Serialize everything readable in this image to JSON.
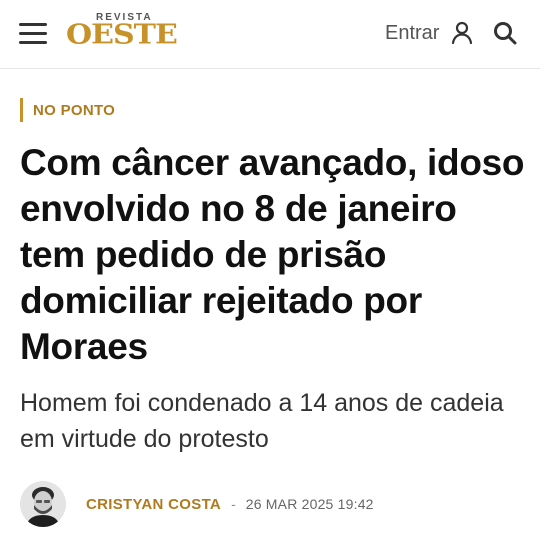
{
  "header": {
    "menu_icon": "hamburger-menu-icon",
    "logo_small": "REVISTA",
    "logo_main": "OESTE",
    "login_label": "Entrar",
    "user_icon": "user-icon",
    "search_icon": "search-icon",
    "brand_color": "#c8922a"
  },
  "article": {
    "section": "NO PONTO",
    "headline": "Com câncer avançado, idoso envolvido no 8 de janeiro tem pedido de prisão domiciliar rejeitado por Moraes",
    "subtitle": "Homem foi condenado a 14 anos de cadeia em virtude do protesto",
    "author": "CRISTYAN COSTA",
    "separator": "-",
    "date": "26 MAR 2025 19:42"
  }
}
